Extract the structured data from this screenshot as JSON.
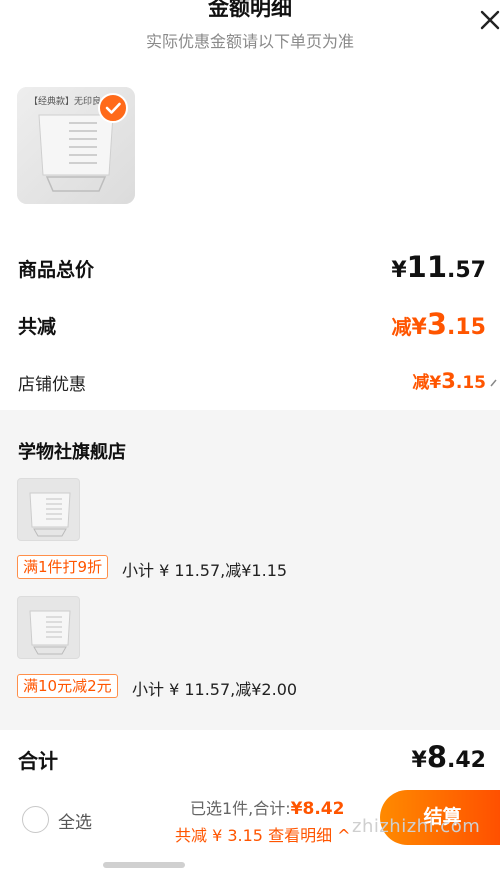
{
  "header": {
    "title": "金额明细",
    "subtitle": "实际优惠金额请以下单页为准"
  },
  "product": {
    "label": "【经典款】无印良"
  },
  "rows": {
    "goods_total": {
      "label": "商品总价",
      "currency": "¥",
      "int": "11",
      "dec": ".57"
    },
    "total_discount": {
      "label": "共减",
      "prefix": "减",
      "currency": "¥",
      "int": "3",
      "dec": ".15"
    },
    "shop_discount": {
      "label": "店铺优惠",
      "prefix": "减",
      "currency": "¥",
      "int": "3",
      "dec": ".15"
    }
  },
  "shop": {
    "name": "学物社旗舰店",
    "items": [
      {
        "promo": "满1件打9折",
        "subtotal": "小计 ¥ 11.57,减¥1.15"
      },
      {
        "promo": "满10元减2元",
        "subtotal": "小计 ¥ 11.57,减¥2.00"
      }
    ]
  },
  "total": {
    "label": "合计",
    "currency": "¥",
    "int": "8",
    "dec": ".42"
  },
  "footer": {
    "select_all": "全选",
    "selected_text": "已选1件,合计:",
    "price": "¥8.42",
    "save_text": "共减 ¥ 3.15 查看明细 ^",
    "checkout": "结算"
  },
  "watermark": "zhizhizhi.com",
  "colors": {
    "accent": "#ff5500",
    "badge": "#ff6a1a"
  }
}
